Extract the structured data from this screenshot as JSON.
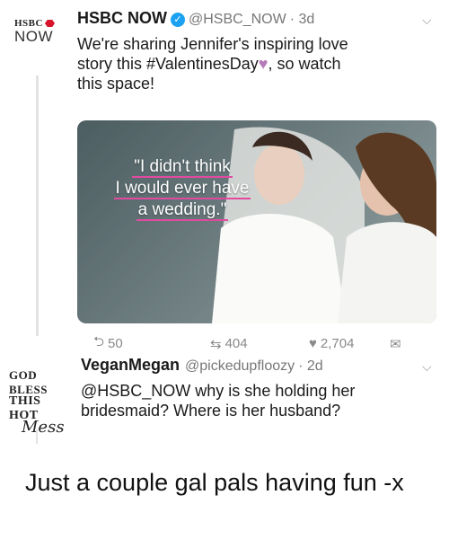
{
  "tweet1": {
    "avatar_line1": "HSBC",
    "avatar_line2": "NOW",
    "name": "HSBC NOW",
    "handle": "@HSBC_NOW",
    "time": "· 3d",
    "text_line1": "We're sharing Jennifer's inspiring love",
    "text_line2a": "story this ",
    "hashtag": "#ValentinesDay",
    "text_line2b": ", so watch",
    "text_line3": "this space!",
    "media_quote_line1": "\"I didn't think",
    "media_quote_line2": "I would ever have",
    "media_quote_line3": "a wedding.\"",
    "replies": "50",
    "retweets": "404",
    "likes": "2,704"
  },
  "tweet2": {
    "avatar_line1": "GOD BLESS",
    "avatar_line2": "THIS HOT",
    "avatar_line3": "Mess",
    "name": "VeganMegan",
    "handle": "@pickedupfloozy",
    "time": "· 2d",
    "mention": "@HSBC_NOW",
    "text_line1b": " why is she holding her",
    "text_line2": "bridesmaid? Where is her husband?"
  },
  "caption": "Just a couple gal pals having fun -x",
  "colors": {
    "verified": "#1da1f2",
    "hashtag": "#1a1a1a",
    "quote_underline": "#e24aa0",
    "hsbc_red": "#d8142a"
  }
}
